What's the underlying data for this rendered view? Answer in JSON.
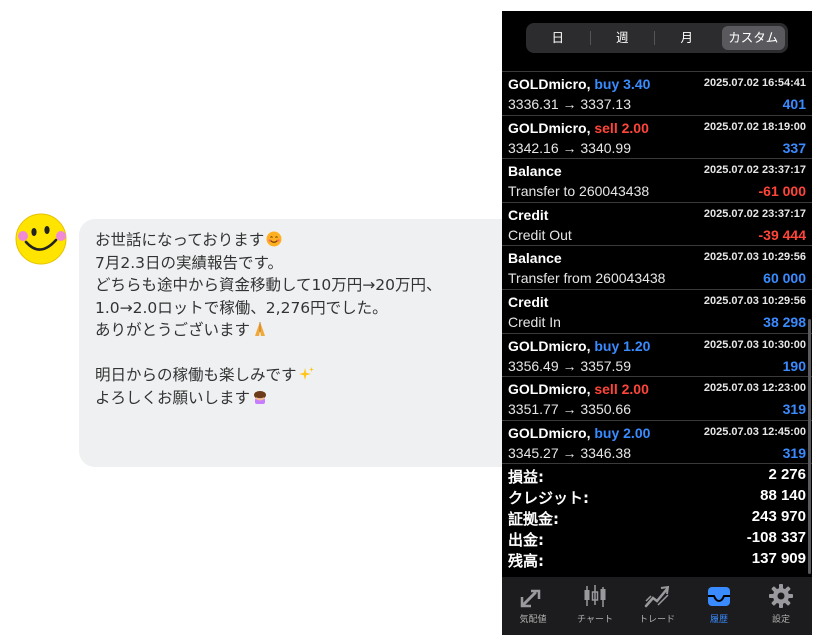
{
  "chat": {
    "lines": [
      "お世話になっております",
      "7月2.3日の実績報告です。",
      "どちらも途中から資金移動して10万円→20万円、",
      "1.0→2.0ロットで稼働、2,276円でした。",
      "ありがとうございます",
      "",
      "明日からの稼働も楽しみです",
      "よろしくお願いします"
    ],
    "line_emojis": [
      "smiling-face-emoji",
      "",
      "",
      "",
      "folded-hands-emoji",
      "",
      "",
      "sparkles-emoji",
      "bowing-person-emoji"
    ]
  },
  "segment": {
    "options": [
      "日",
      "週",
      "月",
      "カスタム"
    ],
    "selected": "カスタム"
  },
  "history": {
    "rows": [
      {
        "symbol": "GOLDmicro,",
        "side": "buy 3.40",
        "side_type": "buy",
        "time": "2025.07.02 16:54:41",
        "detail": "3336.31 → 3337.13",
        "amount": "401",
        "amount_type": "pos"
      },
      {
        "symbol": "GOLDmicro,",
        "side": "sell 2.00",
        "side_type": "sell",
        "time": "2025.07.02 18:19:00",
        "detail": "3342.16 → 3340.99",
        "amount": "337",
        "amount_type": "pos"
      },
      {
        "symbol": "Balance",
        "side": "",
        "side_type": "",
        "time": "2025.07.02 23:37:17",
        "detail": "Transfer to 260043438",
        "amount": "-61 000",
        "amount_type": "neg"
      },
      {
        "symbol": "Credit",
        "side": "",
        "side_type": "",
        "time": "2025.07.02 23:37:17",
        "detail": "Credit Out",
        "amount": "-39 444",
        "amount_type": "neg"
      },
      {
        "symbol": "Balance",
        "side": "",
        "side_type": "",
        "time": "2025.07.03 10:29:56",
        "detail": "Transfer from 260043438",
        "amount": "60 000",
        "amount_type": "pos"
      },
      {
        "symbol": "Credit",
        "side": "",
        "side_type": "",
        "time": "2025.07.03 10:29:56",
        "detail": "Credit In",
        "amount": "38 298",
        "amount_type": "pos"
      },
      {
        "symbol": "GOLDmicro,",
        "side": "buy 1.20",
        "side_type": "buy",
        "time": "2025.07.03 10:30:00",
        "detail": "3356.49 → 3357.59",
        "amount": "190",
        "amount_type": "pos"
      },
      {
        "symbol": "GOLDmicro,",
        "side": "sell 2.00",
        "side_type": "sell",
        "time": "2025.07.03 12:23:00",
        "detail": "3351.77 → 3350.66",
        "amount": "319",
        "amount_type": "pos"
      },
      {
        "symbol": "GOLDmicro,",
        "side": "buy 2.00",
        "side_type": "buy",
        "time": "2025.07.03 12:45:00",
        "detail": "3345.27 → 3346.38",
        "amount": "319",
        "amount_type": "pos"
      }
    ]
  },
  "summary": [
    {
      "label": "損益:",
      "value": "2 276"
    },
    {
      "label": "クレジット:",
      "value": "88 140"
    },
    {
      "label": "証拠金:",
      "value": "243 970"
    },
    {
      "label": "出金:",
      "value": "-108 337"
    },
    {
      "label": "残高:",
      "value": "137 909"
    }
  ],
  "tabbar": {
    "tabs": [
      {
        "label": "気配値",
        "icon": "quotes-icon"
      },
      {
        "label": "チャート",
        "icon": "candlestick-chart-icon"
      },
      {
        "label": "トレード",
        "icon": "trade-icon"
      },
      {
        "label": "履歴",
        "icon": "history-inbox-icon"
      },
      {
        "label": "設定",
        "icon": "gear-icon"
      }
    ],
    "active": "履歴"
  },
  "colors": {
    "buy": "#3a8bff",
    "sell": "#ff453a",
    "bubble": "#eef0f2",
    "panel": "#000000"
  }
}
